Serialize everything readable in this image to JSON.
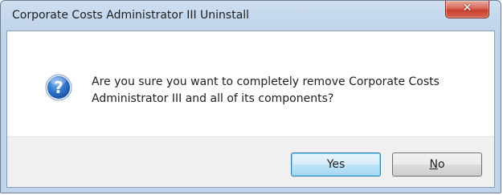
{
  "window": {
    "title": "Corporate Costs Administrator III Uninstall"
  },
  "dialog": {
    "icon": "question-icon",
    "message_line1": "Are you sure you want to completely remove Corporate Costs",
    "message_line2": "Administrator III and all of its components?"
  },
  "buttons": {
    "yes_label": "Yes",
    "no_label_mnemonic": "N",
    "no_label_rest": "o"
  },
  "colors": {
    "close_button": "#c3402f",
    "question_icon": "#1f5fb6",
    "default_button_border": "#3c7fb1"
  }
}
